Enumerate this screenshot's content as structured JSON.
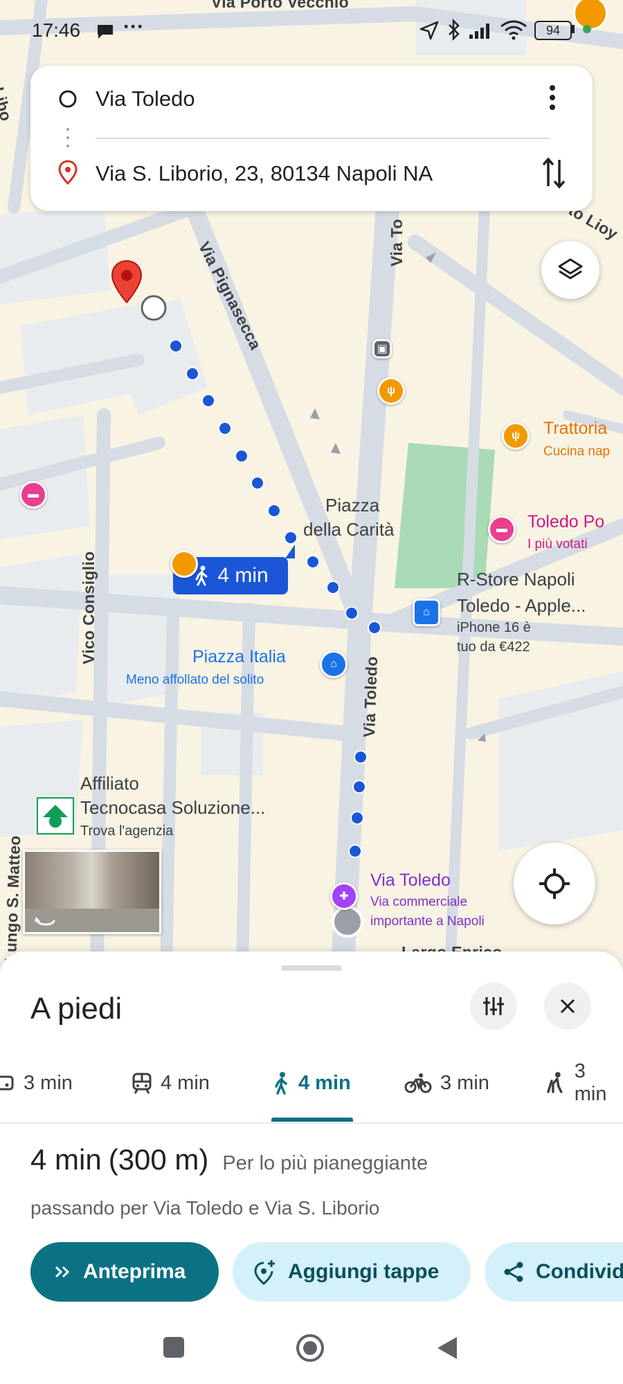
{
  "status_bar": {
    "time": "17:46",
    "notification_icons": [
      "chat-bubble-icon",
      "more-dots-icon"
    ],
    "battery": "94",
    "system_icons": [
      "location-arrow-icon",
      "bluetooth-icon",
      "signal-icon",
      "wifi-icon",
      "battery-icon"
    ]
  },
  "route_card": {
    "origin": "Via Toledo",
    "destination": "Via S. Liborio, 23, 80134 Napoli NA"
  },
  "map": {
    "streets": {
      "top": "Via Porto Vecchio",
      "s_liborio_left": "S. Libo",
      "via_pignasecca": "Via Pignasecca",
      "via_toledo_top": "Via To",
      "via_toledo": "Via Toledo",
      "vico_consiglio": "Vico Consiglio",
      "lungo_s_matteo": "Lungo S. Matteo",
      "via_to_lioy": "to Lioy",
      "largo_enrico": "Largo Enrico"
    },
    "route_badge": "4 min",
    "piazza_carita": [
      "Piazza",
      "della Carità"
    ],
    "trattoria": {
      "name": "Trattoria",
      "subtitle": "Cucina nap"
    },
    "toledo_po": {
      "name": "Toledo Po",
      "subtitle": "I più votati"
    },
    "rstore": {
      "name_line1": "R-Store Napoli",
      "name_line2": "Toledo - Apple...",
      "promo_line1": "iPhone 16 è",
      "promo_line2": "tuo da €422"
    },
    "piazza_italia": {
      "name": "Piazza Italia",
      "subtitle": "Meno affollato del solito"
    },
    "tecnocasa": {
      "line1": "Affiliato",
      "line2": "Tecnocasa Soluzione...",
      "subtitle": "Trova l'agenzia"
    },
    "via_toledo_poi": {
      "name": "Via Toledo",
      "subtitle_line1": "Via commerciale",
      "subtitle_line2": "importante a Napoli"
    },
    "colors": {
      "route": "#1a56d6",
      "park": "#a8dab5",
      "road": "#d6dce4",
      "block": "#faf1d6",
      "building": "#e9ecef"
    }
  },
  "sheet": {
    "title": "A piedi",
    "modes": [
      {
        "icon": "car-icon",
        "label": "3 min"
      },
      {
        "icon": "transit-icon",
        "label": "4 min"
      },
      {
        "icon": "walk-icon",
        "label": "4 min",
        "selected": true
      },
      {
        "icon": "bike-icon",
        "label": "3 min"
      },
      {
        "icon": "scooter-icon",
        "label": "3 min"
      }
    ],
    "summary_time": "4 min",
    "summary_distance": "(300 m)",
    "summary_note": "Per lo più pianeggiante",
    "via_text": "passando per Via Toledo e Via S. Liborio",
    "buttons": {
      "preview": "Anteprima",
      "add_stops": "Aggiungi tappe",
      "share": "Condivid"
    },
    "accent": "#0b7285"
  }
}
